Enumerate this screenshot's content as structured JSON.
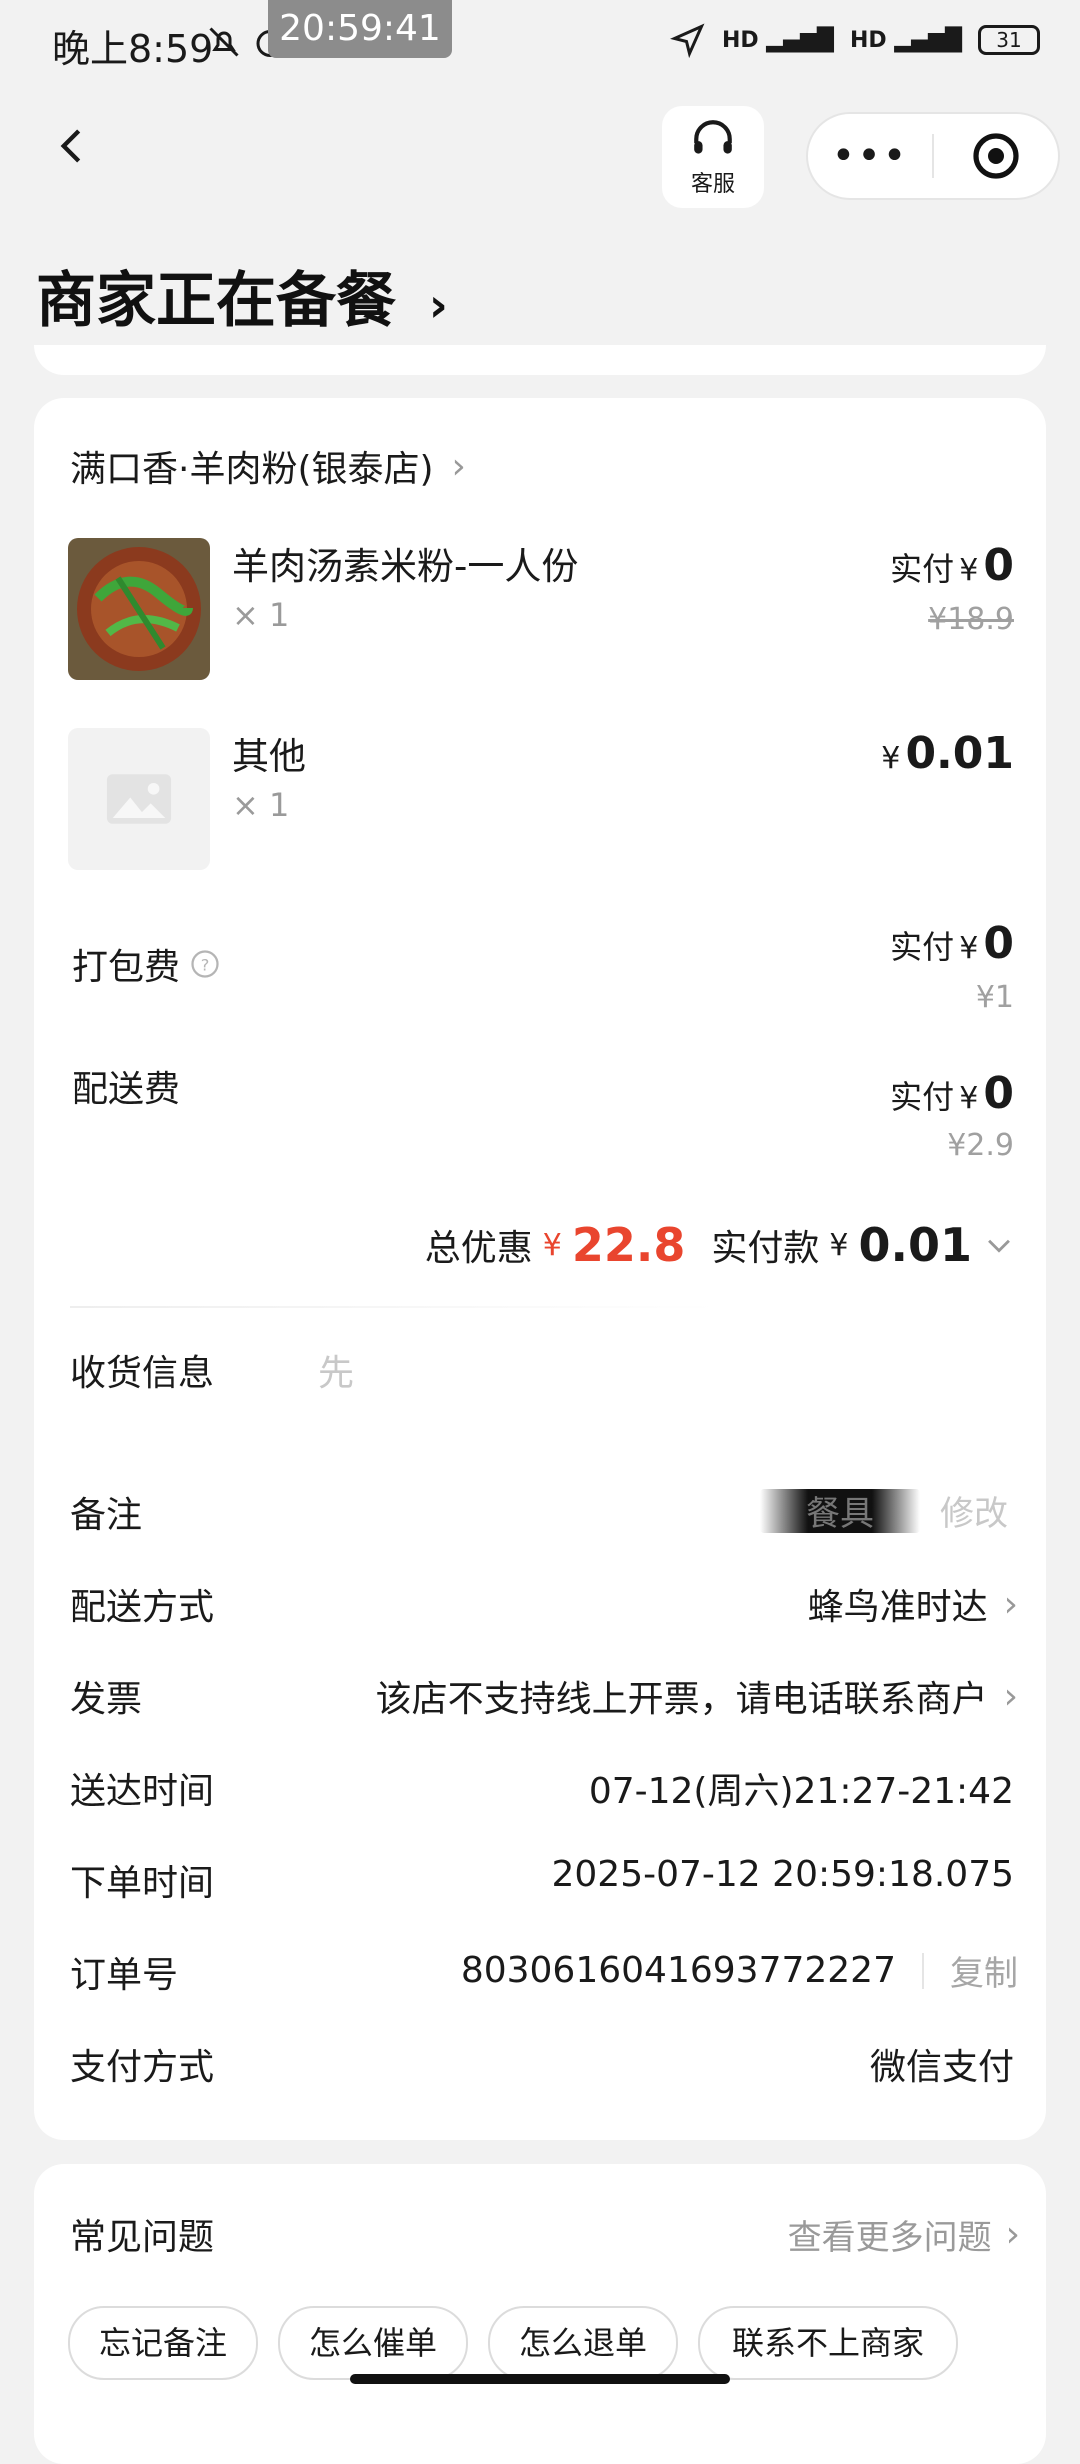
{
  "status_bar": {
    "time": "晚上8:59",
    "overlay_time": "20:59:41",
    "battery": "31"
  },
  "nav": {
    "customer_service_label": "客服",
    "more_label": "•••"
  },
  "order_status": "商家正在备餐",
  "shop": {
    "name": "满口香·羊肉粉(银泰店)"
  },
  "items": [
    {
      "name": "羊肉汤素米粉-一人份",
      "qty": "× 1",
      "paid_label": "实付",
      "paid_value": "0",
      "original": "¥18.9"
    },
    {
      "name": "其他",
      "qty": "× 1",
      "price": "0.01"
    }
  ],
  "fees": [
    {
      "label": "打包费",
      "paid_label": "实付",
      "paid_value": "0",
      "original": "¥1"
    },
    {
      "label": "配送费",
      "paid_label": "实付",
      "paid_value": "0",
      "original": "¥2.9"
    }
  ],
  "summary": {
    "discount_label": "总优惠",
    "discount_value": "22.8",
    "paid_label": "实付款",
    "paid_value": "0.01",
    "yen": "¥"
  },
  "info": {
    "address_label": "收货信息",
    "address_value": "先",
    "remark_label": "备注",
    "remark_value": "餐具",
    "remark_edit": "修改",
    "delivery_label": "配送方式",
    "delivery_value": "蜂鸟准时达",
    "invoice_label": "发票",
    "invoice_value": "该店不支持线上开票，请电话联系商户",
    "arrive_label": "送达时间",
    "arrive_value": "07-12(周六)21:27-21:42",
    "order_time_label": "下单时间",
    "order_time_value": "2025-07-12 20:59:18.075",
    "order_no_label": "订单号",
    "order_no_value": "8030616041693772227",
    "copy_label": "复制",
    "pay_method_label": "支付方式",
    "pay_method_value": "微信支付"
  },
  "faq": {
    "title": "常见问题",
    "more": "查看更多问题",
    "chips": [
      "忘记备注",
      "怎么催单",
      "怎么退单",
      "联系不上商家"
    ]
  },
  "colors": {
    "accent_red": "#e9452e",
    "background": "#f2f2f2"
  }
}
